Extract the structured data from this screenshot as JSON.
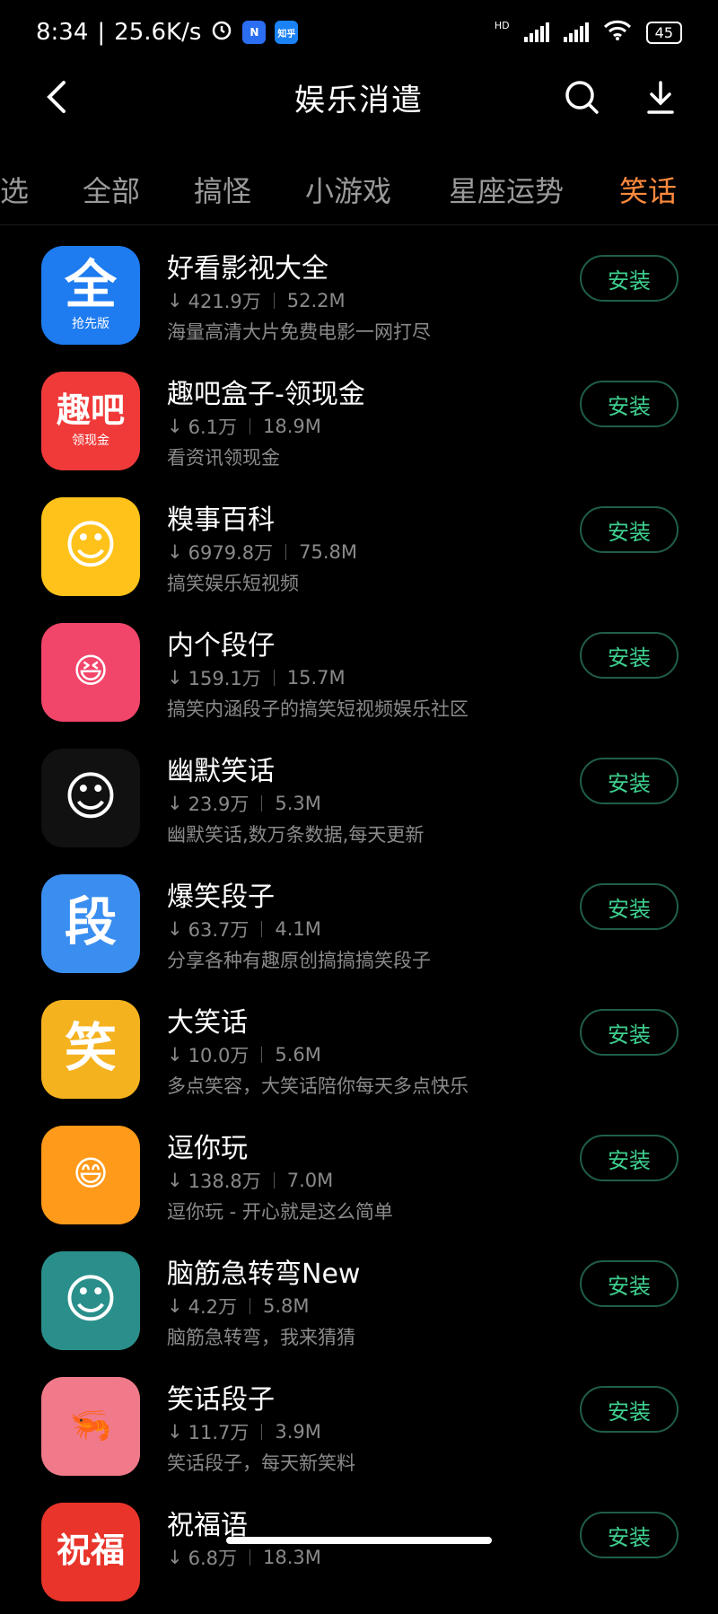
{
  "status": {
    "time": "8:34",
    "speed": "25.6K/s",
    "battery": "45",
    "hd": "HD"
  },
  "header": {
    "title": "娱乐消遣"
  },
  "tabs": [
    "选",
    "全部",
    "搞怪",
    "小游戏",
    "星座运势",
    "笑话"
  ],
  "active_tab": "笑话",
  "install_label": "安装",
  "colors": {
    "accent_orange": "#ff8a3d",
    "install_green": "#3ecf8e",
    "background": "#000000"
  },
  "apps": [
    {
      "name": "好看影视大全",
      "downloads": "421.9万",
      "size": "52.2M",
      "desc": "海量高清大片免费电影一网打尽",
      "icon_text": "全",
      "icon_sub": "抢先版",
      "icon": "video-app-icon",
      "bg": "#1e7bf0"
    },
    {
      "name": "趣吧盒子-领现金",
      "downloads": "6.1万",
      "size": "18.9M",
      "desc": "看资讯领现金",
      "icon_text": "趣吧",
      "icon_sub": "领现金",
      "icon": "cash-box-icon",
      "bg": "#f03a3a"
    },
    {
      "name": "糗事百科",
      "downloads": "6979.8万",
      "size": "75.8M",
      "desc": "搞笑娱乐短视频",
      "icon_text": "☺",
      "icon_sub": "",
      "icon": "poop-face-icon",
      "bg": "#ffc21a"
    },
    {
      "name": "内个段仔",
      "downloads": "159.1万",
      "size": "15.7M",
      "desc": "搞笑内涵段子的搞笑短视频娱乐社区",
      "icon_text": "😆",
      "icon_sub": "",
      "icon": "laughing-face-icon",
      "bg": "#f2456a"
    },
    {
      "name": "幽默笑话",
      "downloads": "23.9万",
      "size": "5.3M",
      "desc": "幽默笑话,数万条数据,每天更新",
      "icon_text": "☺",
      "icon_sub": "",
      "icon": "glasses-face-icon",
      "bg": "#111111"
    },
    {
      "name": "爆笑段子",
      "downloads": "63.7万",
      "size": "4.1M",
      "desc": "分享各种有趣原创搞搞搞笑段子",
      "icon_text": "段",
      "icon_sub": "",
      "icon": "duan-character-icon",
      "bg": "#3a8ef0"
    },
    {
      "name": "大笑话",
      "downloads": "10.0万",
      "size": "5.6M",
      "desc": "多点笑容，大笑话陪你每天多点快乐",
      "icon_text": "笑",
      "icon_sub": "",
      "icon": "xiao-character-icon",
      "bg": "#f5b21f"
    },
    {
      "name": "逗你玩",
      "downloads": "138.8万",
      "size": "7.0M",
      "desc": "逗你玩 - 开心就是这么简单",
      "icon_text": "😄",
      "icon_sub": "",
      "icon": "laughing-boy-icon",
      "bg": "#ff9a1a"
    },
    {
      "name": "脑筋急转弯New",
      "downloads": "4.2万",
      "size": "5.8M",
      "desc": "脑筋急转弯，我来猜猜",
      "icon_text": "☺",
      "icon_sub": "",
      "icon": "robot-face-icon",
      "bg": "#2a8f8a"
    },
    {
      "name": "笑话段子",
      "downloads": "11.7万",
      "size": "3.9M",
      "desc": "笑话段子，每天新笑料",
      "icon_text": "🦐",
      "icon_sub": "",
      "icon": "shrimp-meme-icon",
      "bg": "#f07a8a"
    },
    {
      "name": "祝福语",
      "downloads": "6.8万",
      "size": "18.3M",
      "desc": "",
      "icon_text": "祝福",
      "icon_sub": "",
      "icon": "blessing-characters-icon",
      "bg": "#e8342a"
    }
  ]
}
